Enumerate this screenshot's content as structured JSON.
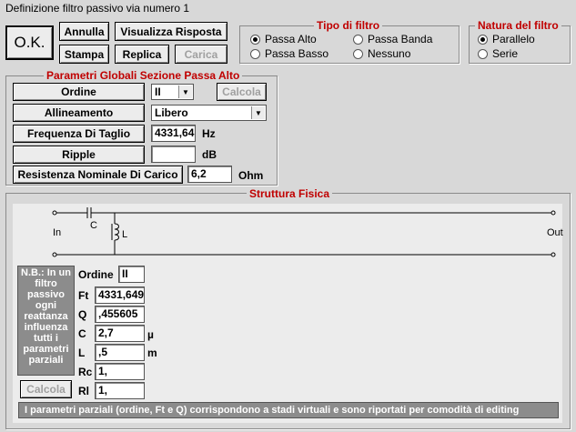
{
  "window": {
    "title": "Definizione filtro passivo via numero 1"
  },
  "toolbar": {
    "ok_label": "O.K.",
    "annulla_label": "Annulla",
    "visualizza_label": "Visualizza Risposta",
    "stampa_label": "Stampa",
    "replica_label": "Replica",
    "carica_label": "Carica"
  },
  "tipo_filtro": {
    "title": "Tipo di filtro",
    "options": [
      "Passa Alto",
      "Passa Banda",
      "Passa Basso",
      "Nessuno"
    ],
    "selected": "Passa Alto"
  },
  "natura_filtro": {
    "title": "Natura del filtro",
    "options": [
      "Parallelo",
      "Serie"
    ],
    "selected": "Parallelo"
  },
  "parametri_globali": {
    "title": "Parametri Globali Sezione Passa Alto",
    "ordine_label": "Ordine",
    "ordine_value": "II",
    "calcola_label": "Calcola",
    "allineamento_label": "Allineamento",
    "allineamento_value": "Libero",
    "frequenza_label": "Frequenza Di Taglio",
    "frequenza_value": "4331,64",
    "frequenza_unit": "Hz",
    "ripple_label": "Ripple",
    "ripple_value": "",
    "ripple_unit": "dB",
    "resistenza_label": "Resistenza Nominale Di Carico",
    "resistenza_value": "6,2",
    "resistenza_unit": "Ohm"
  },
  "struttura": {
    "title": "Struttura Fisica",
    "in_label": "In",
    "out_label": "Out",
    "c_label": "C",
    "l_label": "L",
    "note": "N.B.: In un filtro passivo ogni reattanza influenza tutti i parametri parziali",
    "fields": [
      {
        "label": "Ordine",
        "value": "II",
        "unit": ""
      },
      {
        "label": "Ft",
        "value": "4331,649",
        "unit": ""
      },
      {
        "label": "Q",
        "value": ",455605",
        "unit": ""
      },
      {
        "label": "C",
        "value": "2,7",
        "unit": "µ"
      },
      {
        "label": "L",
        "value": ",5",
        "unit": "m"
      },
      {
        "label": "Rc",
        "value": "1,",
        "unit": ""
      },
      {
        "label": "Rl",
        "value": "1,",
        "unit": ""
      }
    ],
    "calcola_label": "Calcola",
    "footer": "I parametri parziali (ordine, Ft e Q) corrispondono a stadi virtuali e sono riportati per comodità di editing"
  }
}
